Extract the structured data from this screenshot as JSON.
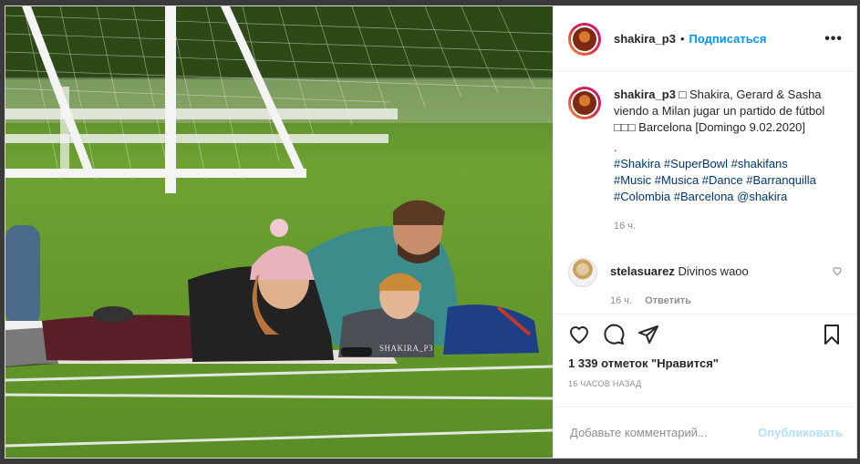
{
  "post": {
    "username": "shakira_p3",
    "separator": "•",
    "follow_label": "Подписаться",
    "more_label": "•••",
    "caption": {
      "username": "shakira_p3",
      "text": " □ Shakira, Gerard & Sasha viendo a Milan jugar un partido de fútbol □□□ Barcelona [Domingo 9.02.2020]",
      "dot": ".",
      "hashtags_line1": "#Shakira #SuperBowl #shakifans",
      "hashtags_line2": "#Music #Musica #Dance #Barranquilla",
      "hashtags_line3": "#Colombia #Barcelona @shakira",
      "time": "16 ч."
    },
    "comment": {
      "username": "stelasuarez",
      "text": " Divinos waoo",
      "time": "16 ч.",
      "reply_label": "Ответить"
    },
    "likes": "1 339 отметок \"Нравится\"",
    "posted_ago": "16 ЧАСОВ НАЗАД",
    "add_comment_placeholder": "Добавьте комментарий...",
    "publish_label": "Опубликовать",
    "photo_watermark": "SHAKIRA_P3"
  },
  "icons": {
    "like": "heart-icon",
    "comment": "comment-icon",
    "share": "paper-plane-icon",
    "save": "bookmark-icon"
  },
  "colors": {
    "link": "#0095f6",
    "hashtag": "#00376b",
    "muted": "#8e8e8e",
    "publish_disabled": "#b2dffc"
  }
}
